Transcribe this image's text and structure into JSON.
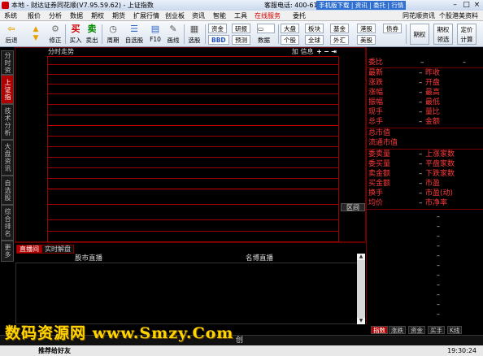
{
  "titlebar": {
    "title": "本地 - 财达证券同花顺(V7.95.59.62) - 上证指数",
    "hotline": "客服电话: 400-612-8888",
    "mobile": "手机版下载 | 资讯 | 委托 | 行情"
  },
  "menu": [
    "系统",
    "报价",
    "分析",
    "数据",
    "期权",
    "期货",
    "扩展行情",
    "创业板",
    "资讯",
    "智能",
    "工具",
    "在线服务",
    "委托"
  ],
  "menu_right": [
    "同花顺资讯",
    "个股港美资料"
  ],
  "toolbar": {
    "buttons": [
      "后退",
      "前进",
      "修正",
      "买入",
      "卖出",
      "周期",
      "自选股",
      "F10",
      "画线",
      "选股"
    ],
    "mini": [
      "资金",
      "研报",
      "大盘",
      "板块",
      "基金",
      "港股",
      "债券",
      "BBD",
      "预测",
      "个股",
      "全球",
      "外汇",
      "美股"
    ],
    "data_label": "数据",
    "big": [
      "期权",
      "期权领选",
      "定价计算"
    ]
  },
  "left_tabs": [
    "分时资讯",
    "上证指数",
    "技术分析",
    "大盘资讯",
    "自选股",
    "综合排名",
    "更多"
  ],
  "chart": {
    "title": "分时走势",
    "tools": {
      "add": "加",
      "info": "信息"
    },
    "exit_label": "区间"
  },
  "news": {
    "tabs": [
      "直播间",
      "实时解盘"
    ],
    "col1": "股市直播",
    "col2": "名博直播"
  },
  "quote": {
    "rows1": [
      [
        "委比",
        "–",
        ""
      ]
    ],
    "rows2": [
      [
        "最新",
        "–",
        "昨收"
      ],
      [
        "涨跌",
        "–",
        "开盘"
      ],
      [
        "涨幅",
        "–",
        "最高"
      ],
      [
        "振幅",
        "–",
        "最低"
      ],
      [
        "现手",
        "–",
        "量比"
      ],
      [
        "总手",
        "–",
        "金额"
      ]
    ],
    "rows3": [
      [
        "总市值",
        ""
      ],
      [
        "流通市值",
        ""
      ]
    ],
    "rows4": [
      [
        "委卖量",
        "–",
        "上涨家数"
      ],
      [
        "委买量",
        "–",
        "平盘家数"
      ],
      [
        "卖金额",
        "–",
        "下跌家数"
      ],
      [
        "买金额",
        "–",
        "市盈"
      ],
      [
        "换手",
        "–",
        "市盈(动)"
      ],
      [
        "均价",
        "–",
        "市净率"
      ]
    ]
  },
  "quote_tabs": [
    "指数",
    "涨跌",
    "资金",
    "买手",
    "K线"
  ],
  "bottom": {
    "char": "创"
  },
  "status": {
    "recommend": "推荐给好友",
    "time": "19:30:24"
  },
  "watermark": "数码资源网 www.Smzy.Com"
}
